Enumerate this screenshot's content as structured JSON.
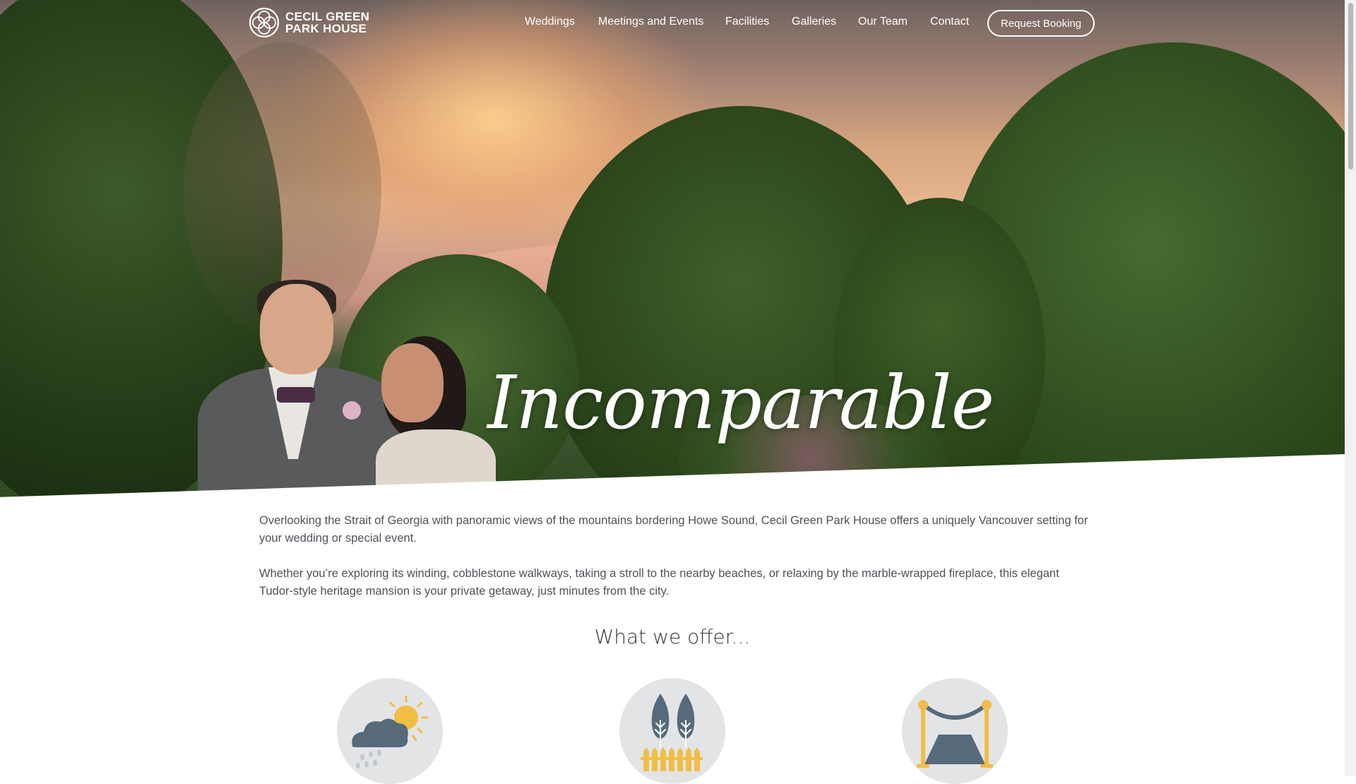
{
  "brand": {
    "name_line1": "CECIL GREEN",
    "name_line2": "PARK HOUSE"
  },
  "nav": {
    "items": [
      {
        "label": "Weddings"
      },
      {
        "label": "Meetings and Events"
      },
      {
        "label": "Facilities"
      },
      {
        "label": "Galleries"
      },
      {
        "label": "Our Team"
      },
      {
        "label": "Contact"
      }
    ],
    "cta_label": "Request Booking"
  },
  "hero": {
    "headline": "Incomparable"
  },
  "intro": {
    "paragraph1": "Overlooking the Strait of Georgia with panoramic views of the mountains bordering Howe Sound, Cecil Green Park House offers a uniquely Vancouver setting for your wedding or special event.",
    "paragraph2": "Whether you’re exploring its winding, cobblestone walkways, taking a stroll to the nearby beaches, or relaxing by the marble-wrapped fireplace, this elegant Tudor-style heritage mansion is your private getaway, just minutes from the city."
  },
  "offer": {
    "title": "What we offer...",
    "icons": [
      "weather-icon",
      "trees-garden-icon",
      "red-carpet-icon"
    ]
  },
  "colors": {
    "accent_yellow": "#f0bd45",
    "icon_slate": "#566a7b",
    "icon_bg": "#e3e4e6",
    "text": "#4d5258"
  }
}
